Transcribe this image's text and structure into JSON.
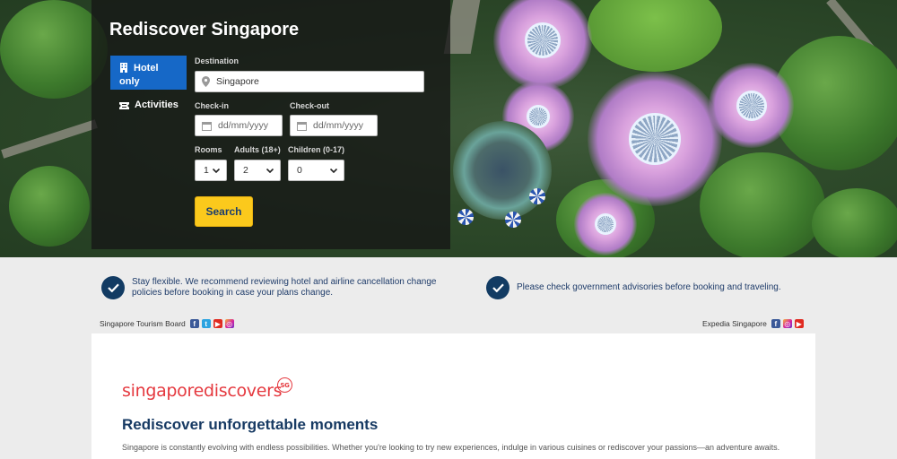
{
  "search": {
    "title": "Rediscover Singapore",
    "tabs": [
      {
        "label": "Hotel only",
        "icon": "building-icon",
        "active": true
      },
      {
        "label": "Activities",
        "icon": "ticket-icon",
        "active": false
      }
    ],
    "destination": {
      "label": "Destination",
      "value": "Singapore"
    },
    "checkin": {
      "label": "Check-in",
      "placeholder": "dd/mm/yyyy"
    },
    "checkout": {
      "label": "Check-out",
      "placeholder": "dd/mm/yyyy"
    },
    "rooms": {
      "label": "Rooms",
      "value": "1"
    },
    "adults": {
      "label": "Adults (18+)",
      "value": "2"
    },
    "children": {
      "label": "Children (0-17)",
      "value": "0"
    },
    "search_button": "Search"
  },
  "notices": [
    {
      "text": "Stay flexible. We recommend reviewing hotel and airline cancellation change policies before booking in case your plans change."
    },
    {
      "text": "Please check government advisories before booking and traveling."
    }
  ],
  "social_left": {
    "name": "Singapore Tourism Board",
    "icons": [
      "facebook-icon",
      "twitter-icon",
      "youtube-icon",
      "instagram-icon"
    ]
  },
  "social_right": {
    "name": "Expedia Singapore",
    "icons": [
      "facebook-icon",
      "instagram-icon",
      "youtube-icon"
    ]
  },
  "content": {
    "brand_logo": "singaporediscovers",
    "brand_badge": "SG",
    "heading": "Rediscover unforgettable moments",
    "body": "Singapore is constantly evolving with endless possibilities. Whether you're looking to try new experiences, indulge in various cuisines or rediscover your passions—an adventure awaits."
  },
  "colors": {
    "panel_bg": "#161616",
    "active_tab": "#1668c7",
    "search_button": "#fbc91c",
    "check_badge": "#123b63",
    "brand_red": "#e5393f",
    "heading": "#173a63"
  }
}
